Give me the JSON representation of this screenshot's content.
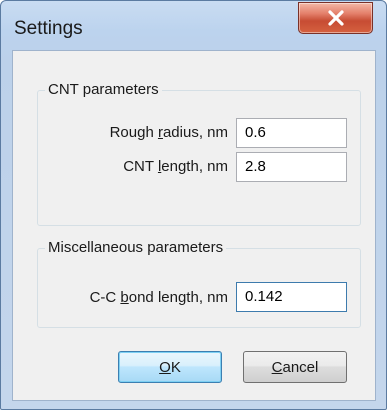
{
  "window": {
    "title": "Settings",
    "close_symbol": "close-x-icon"
  },
  "groups": {
    "cnt": {
      "label": "CNT parameters",
      "rough_radius": {
        "label_pre": "Rough ",
        "label_accel": "r",
        "label_post": "adius, nm",
        "value": "0.6"
      },
      "cnt_length": {
        "label_pre": "CNT ",
        "label_accel": "l",
        "label_post": "ength, nm",
        "value": "2.8"
      }
    },
    "misc": {
      "label": "Miscellaneous parameters",
      "bond_length": {
        "label_pre": "C-C ",
        "label_accel": "b",
        "label_post": "ond length, nm",
        "value": "0.142"
      }
    }
  },
  "buttons": {
    "ok": {
      "accel": "O",
      "rest": "K"
    },
    "cancel": {
      "accel": "C",
      "rest": "ancel"
    }
  },
  "colors": {
    "title_bar": "#c9dcf2",
    "close_button": "#c74c33",
    "client_bg": "#f0f0f0",
    "focus_border": "#3d7bad"
  }
}
